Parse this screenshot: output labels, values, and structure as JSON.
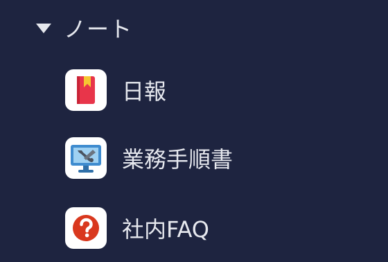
{
  "sidebar": {
    "section_title": "ノート",
    "section_expanded": true,
    "items": [
      {
        "label": "日報",
        "icon": "red-book-bookmark-icon"
      },
      {
        "label": "業務手順書",
        "icon": "monitor-wrench-icon"
      },
      {
        "label": "社内FAQ",
        "icon": "question-mark-circle-icon"
      }
    ]
  },
  "colors": {
    "background": "#1e2440",
    "text": "#e6e8ee",
    "icon_tile": "#ffffff",
    "book_red": "#e8354a",
    "bookmark_yellow": "#f6c632",
    "monitor_blue": "#3f8ccf",
    "question_red": "#d9381e"
  }
}
